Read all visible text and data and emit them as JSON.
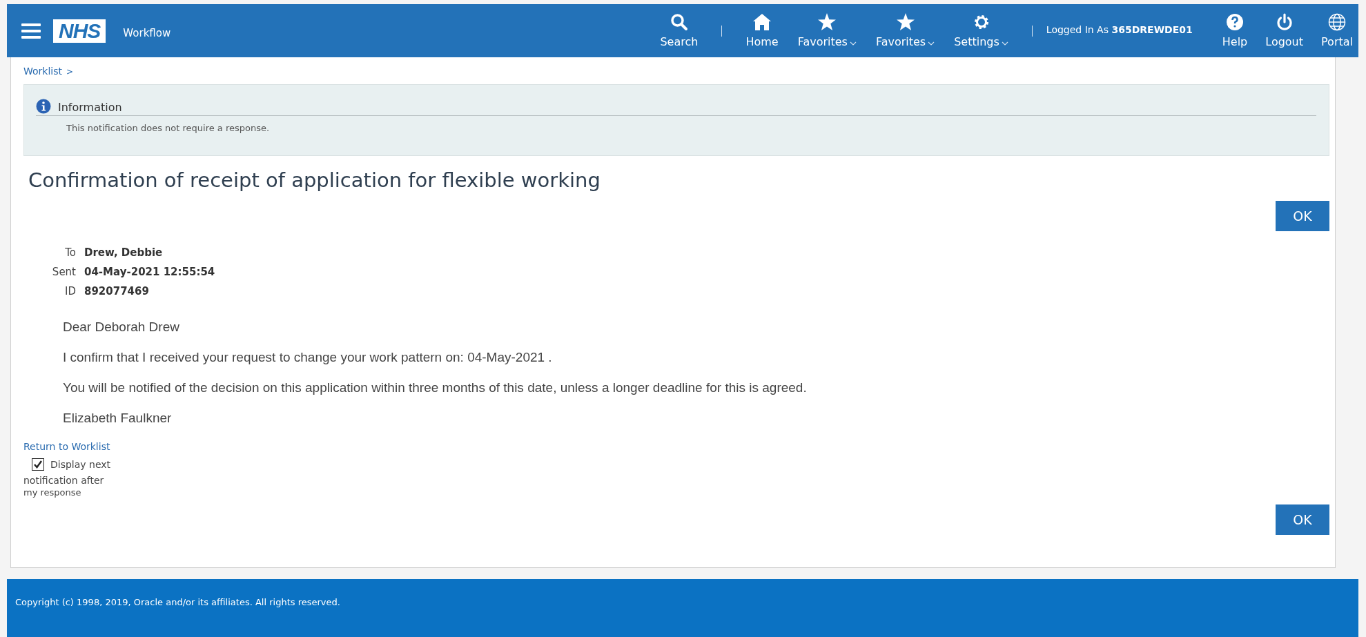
{
  "header": {
    "logo": "NHS",
    "app_name": "Workflow",
    "nav": [
      {
        "kind": "link",
        "label": "Search",
        "dropdown": false
      },
      {
        "kind": "separator"
      },
      {
        "kind": "link",
        "label": "Home",
        "dropdown": false
      },
      {
        "kind": "link",
        "label": "Favorites",
        "dropdown": true
      },
      {
        "kind": "link",
        "label": "Favorites",
        "dropdown": true
      },
      {
        "kind": "link",
        "label": "Settings",
        "dropdown": true
      },
      {
        "kind": "separator"
      }
    ],
    "user_text": "Logged In As **365DREWDE01**",
    "actions": [
      {
        "label": "Help"
      },
      {
        "label": "Logout"
      },
      {
        "label": "Portal"
      }
    ]
  },
  "breadcrumb": {
    "label": "Worklist",
    "separator": ">"
  },
  "info": {
    "title": "Information",
    "message": "This notification does not require a response."
  },
  "page_title": "Confirmation of receipt of application for flexible working",
  "buttons": [
    "OK",
    "OK"
  ],
  "details": [
    {
      "label": "To",
      "value": "Drew, Debbie"
    },
    {
      "label": "Sent",
      "value": "04-May-2021 12:55:54"
    },
    {
      "label": "ID",
      "value": "892077469"
    }
  ],
  "message": [
    "Dear Deborah Drew",
    "I confirm that I received your request to change your work pattern on: 04-May-2021 .",
    "You will be notified of the decision on this application within three months of this date, unless a longer deadline for this is agreed.",
    "Elizabeth Faulkner"
  ],
  "return_link": "Return to Worklist",
  "display_next": {
    "label_lines": [
      "Display next",
      "notification after",
      "my response"
    ],
    "checked": true
  },
  "footer": "Copyright (c) 1998, 2019, Oracle and/or its affiliates. All rights reserved."
}
